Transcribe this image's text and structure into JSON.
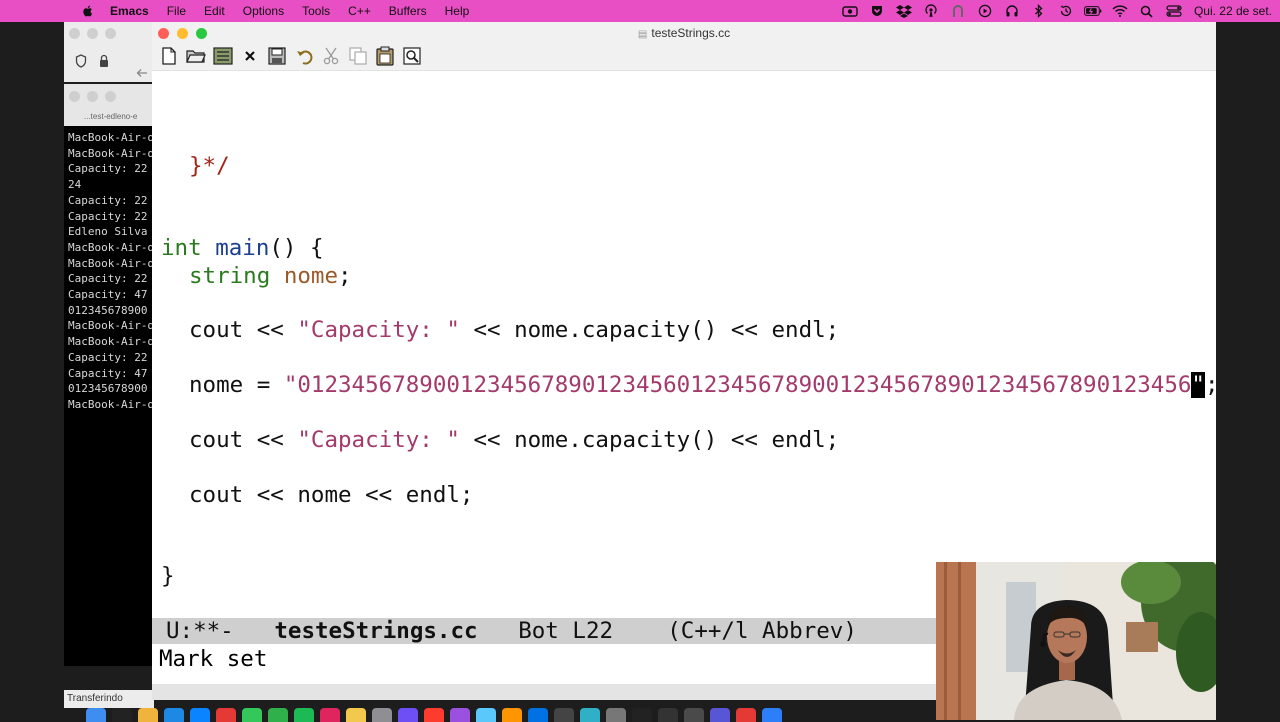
{
  "menubar": {
    "app_name": "Emacs",
    "items": [
      "File",
      "Edit",
      "Options",
      "Tools",
      "C++",
      "Buffers",
      "Help"
    ],
    "status_icons": [
      "camera-icon",
      "pocket-icon",
      "dropbox-icon",
      "broadcast-icon",
      "grammarly-icon",
      "play-icon",
      "headphones-icon",
      "bluetooth-icon",
      "time-machine-icon",
      "battery-icon",
      "wifi-icon",
      "search-icon",
      "control-center-icon"
    ],
    "clock": "Qui. 22 de set.",
    "color": "#e94fc4"
  },
  "terminal": {
    "title": "...test-edleno-e",
    "lines": [
      "MacBook-Air-d",
      "MacBook-Air-d",
      "Capacity: 22",
      "24",
      "Capacity: 22",
      "Capacity: 22",
      "Edleno Silva",
      "MacBook-Air-d",
      "MacBook-Air-d",
      "Capacity: 22",
      "Capacity: 47",
      "012345678900",
      "MacBook-Air-d",
      "MacBook-Air-d",
      "Capacity: 22",
      "Capacity: 47",
      "012345678900",
      "MacBook-Air-d"
    ],
    "status_label": "Transferindo"
  },
  "emacs": {
    "window_title": "testeStrings.cc",
    "toolbar": [
      "new-file-icon",
      "open-folder-icon",
      "dired-icon",
      "close-icon",
      "save-icon",
      "undo-icon",
      "cut-icon",
      "copy-icon",
      "paste-icon",
      "search-icon"
    ],
    "code": {
      "comment_end": "}*/",
      "main_type": "int",
      "main_name": "main",
      "main_rest": "() {",
      "decl_type": "string",
      "decl_var": "nome",
      "decl_end": ";",
      "cout1_pre": "cout << ",
      "cout1_str": "\"Capacity: \"",
      "cout1_post": " << nome.capacity() << endl;",
      "assign_pre": "nome = ",
      "assign_str": "\"012345678900123456789012345601234567890012345678901234567890123456",
      "assign_cursor": "\"",
      "assign_end": ";",
      "cout2_pre": "cout << ",
      "cout2_str": "\"Capacity: \"",
      "cout2_post": " << nome.capacity() << endl;",
      "cout3": "cout << nome << endl;",
      "close_brace": "}"
    },
    "modeline": {
      "status": "U:**-",
      "buffer": "testeStrings.cc",
      "position": "Bot L22",
      "mode": "(C++/l Abbrev)"
    },
    "minibuffer": "Mark set"
  },
  "colors": {
    "keyword": "#2a7a1e",
    "function": "#1b3f91",
    "variable": "#9b5a2a",
    "string": "#a33a6b",
    "comment": "#a12519"
  }
}
